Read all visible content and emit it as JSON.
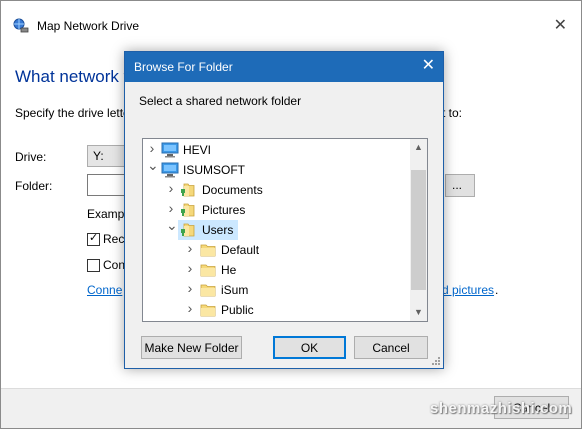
{
  "background_window": {
    "title": "Map Network Drive",
    "heading": "What network fo",
    "description_left": "Specify the drive lette",
    "description_right": "t to:",
    "drive_label": "Drive:",
    "drive_value": "Y:",
    "folder_label": "Folder:",
    "browse_label": "...",
    "example_label": "Exampl",
    "reconnect_label": "Reco",
    "reconnect_checked": true,
    "credentials_label": "Con",
    "credentials_checked": false,
    "link_left": "Conne",
    "link_right": "d pictures",
    "link_suffix": ".",
    "cancel_label": "Cancel"
  },
  "dialog": {
    "title": "Browse For Folder",
    "close_glyph": "✕",
    "instruction": "Select a shared network folder",
    "tree": [
      {
        "label": "HEVI",
        "icon": "computer-icon",
        "expanded": false,
        "level": 0,
        "selected": false
      },
      {
        "label": "ISUMSOFT",
        "icon": "computer-icon",
        "expanded": true,
        "level": 0,
        "selected": false
      },
      {
        "label": "Documents",
        "icon": "shared-folder-icon",
        "expanded": false,
        "level": 1,
        "selected": false
      },
      {
        "label": "Pictures",
        "icon": "shared-folder-icon",
        "expanded": false,
        "level": 1,
        "selected": false
      },
      {
        "label": "Users",
        "icon": "shared-folder-icon",
        "expanded": true,
        "level": 1,
        "selected": true
      },
      {
        "label": "Default",
        "icon": "folder-icon",
        "expanded": false,
        "level": 2,
        "selected": false
      },
      {
        "label": "He",
        "icon": "folder-icon",
        "expanded": false,
        "level": 2,
        "selected": false
      },
      {
        "label": "iSum",
        "icon": "folder-icon",
        "expanded": false,
        "level": 2,
        "selected": false
      },
      {
        "label": "Public",
        "icon": "folder-icon",
        "expanded": false,
        "level": 2,
        "selected": false
      }
    ],
    "buttons": {
      "make_new_folder": "Make New Folder",
      "ok": "OK",
      "cancel": "Cancel"
    }
  },
  "watermark": "shenmazhishi.com",
  "colors": {
    "dialog_titlebar": "#1e6bb8",
    "selection": "#cce8ff",
    "link": "#0066cc",
    "heading": "#003399",
    "folder": "#f5d87a"
  }
}
